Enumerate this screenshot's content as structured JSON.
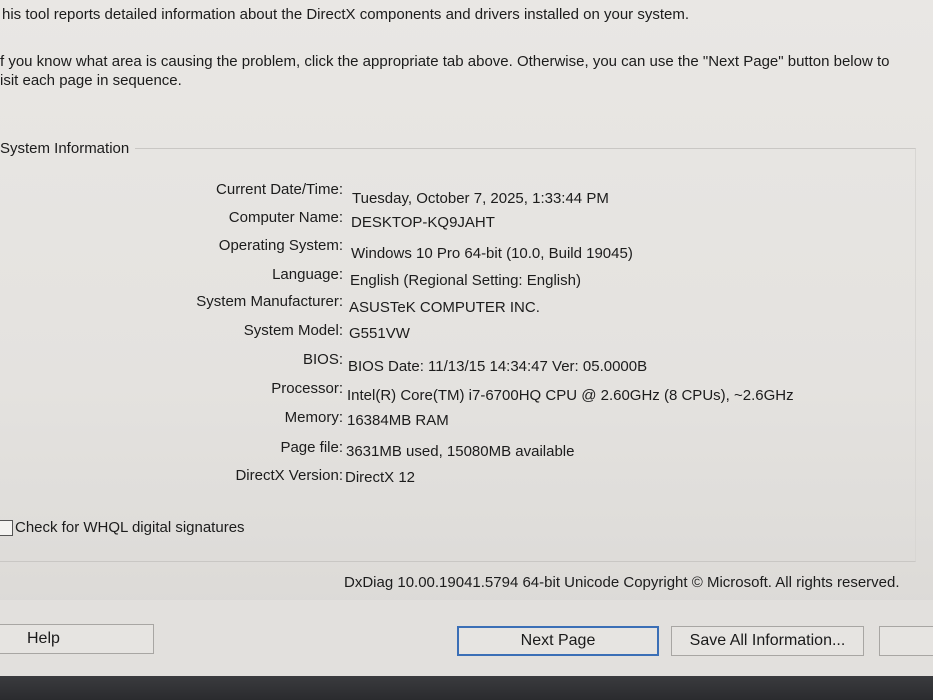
{
  "intro": {
    "line1": "his tool reports detailed information about the DirectX components and drivers installed on your system.",
    "line2": "f you know what area is causing the problem, click the appropriate tab above.  Otherwise, you can use the \"Next Page\" button below to",
    "line3": "isit each page in sequence."
  },
  "system_info": {
    "title": "System Information",
    "rows": [
      {
        "label": "Current Date/Time:",
        "value": "Tuesday, October 7, 2025, 1:33:44 PM"
      },
      {
        "label": "Computer Name:",
        "value": "DESKTOP-KQ9JAHT"
      },
      {
        "label": "Operating System:",
        "value": "Windows 10 Pro 64-bit (10.0, Build 19045)"
      },
      {
        "label": "Language:",
        "value": "English (Regional Setting: English)"
      },
      {
        "label": "System Manufacturer:",
        "value": "ASUSTeK COMPUTER INC."
      },
      {
        "label": "System Model:",
        "value": "G551VW"
      },
      {
        "label": "BIOS:",
        "value": "BIOS Date: 11/13/15 14:34:47 Ver: 05.0000B"
      },
      {
        "label": "Processor:",
        "value": "Intel(R) Core(TM) i7-6700HQ CPU @ 2.60GHz (8 CPUs), ~2.6GHz"
      },
      {
        "label": "Memory:",
        "value": "16384MB RAM"
      },
      {
        "label": "Page file:",
        "value": "3631MB used, 15080MB available"
      },
      {
        "label": "DirectX Version:",
        "value": "DirectX 12"
      }
    ]
  },
  "whql_label": "Check for WHQL digital signatures",
  "footer": "DxDiag 10.00.19041.5794 64-bit Unicode  Copyright © Microsoft. All rights reserved.",
  "buttons": {
    "help": "Help",
    "next_page": "Next Page",
    "save_all": "Save All Information...",
    "exit": ""
  }
}
